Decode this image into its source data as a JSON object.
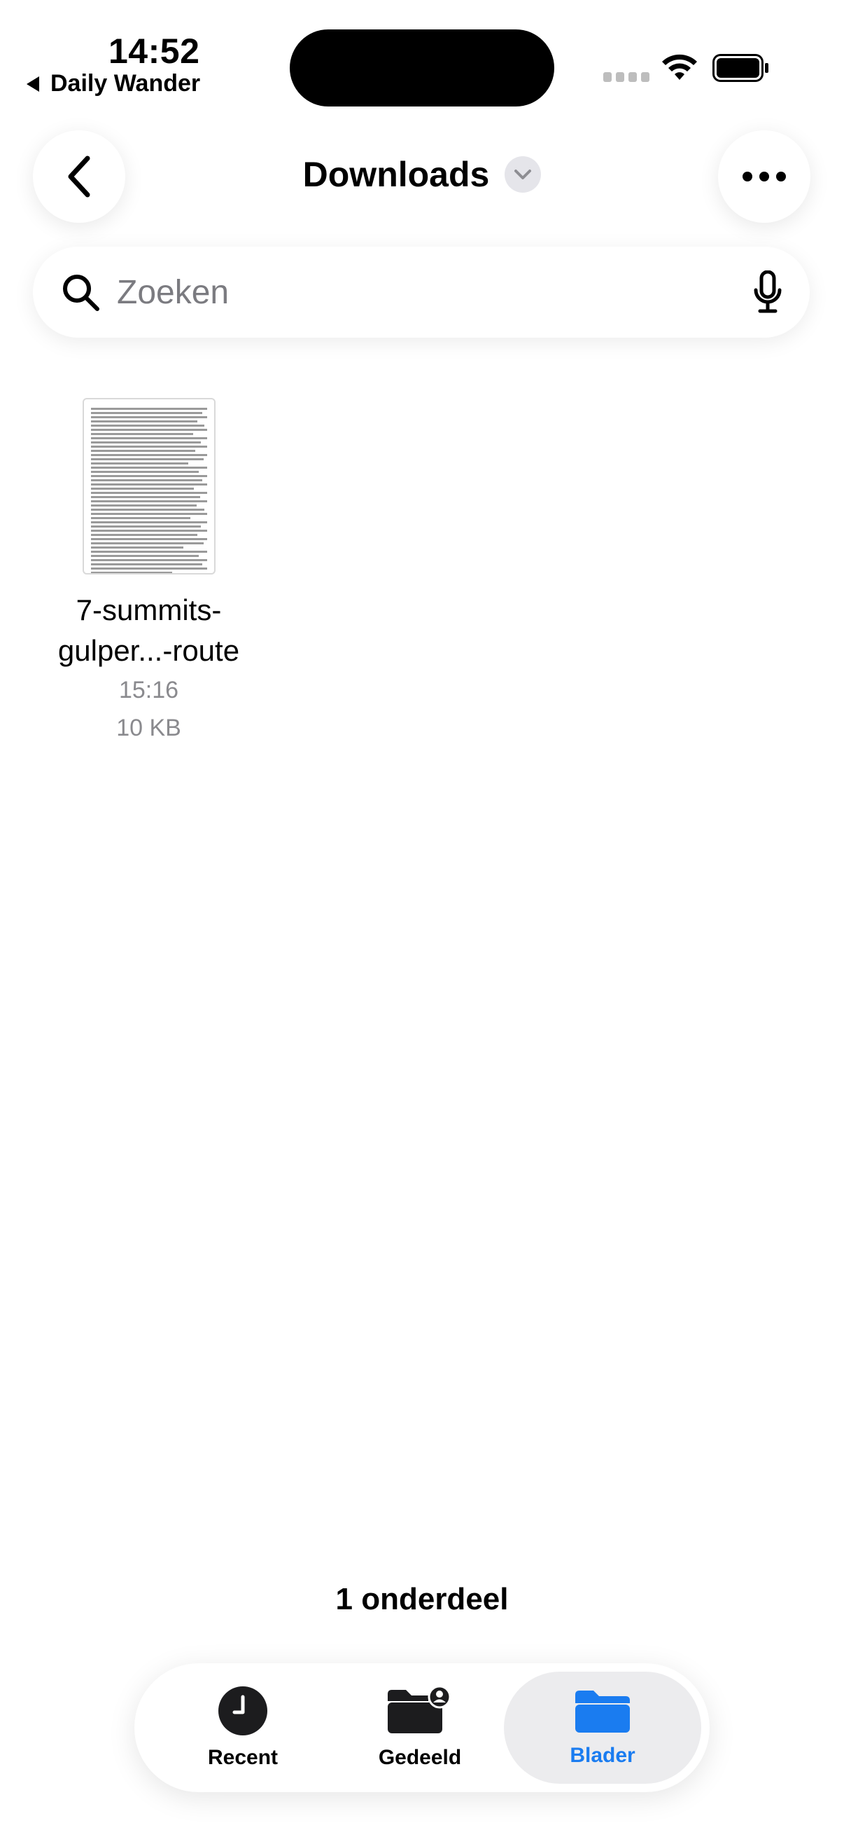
{
  "status_bar": {
    "time": "14:52",
    "back_app": "Daily Wander"
  },
  "header": {
    "title": "Downloads",
    "back_icon": "chevron-left-icon",
    "more_icon": "ellipsis-icon"
  },
  "search": {
    "placeholder": "Zoeken",
    "icon": "search-icon",
    "mic_icon": "microphone-icon"
  },
  "files": [
    {
      "name_line1": "7-summits-",
      "name_line2": "gulper...-route",
      "time": "15:16",
      "size": "10 KB"
    }
  ],
  "footer": {
    "count": "1 onderdeel"
  },
  "tabbar": {
    "tabs": [
      {
        "label": "Recent",
        "icon": "clock-icon"
      },
      {
        "label": "Gedeeld",
        "icon": "shared-folder-icon"
      },
      {
        "label": "Blader",
        "icon": "folder-icon",
        "selected": true
      }
    ]
  },
  "colors": {
    "accent": "#1a7cf0",
    "selected_tab_bg": "#ececee"
  }
}
